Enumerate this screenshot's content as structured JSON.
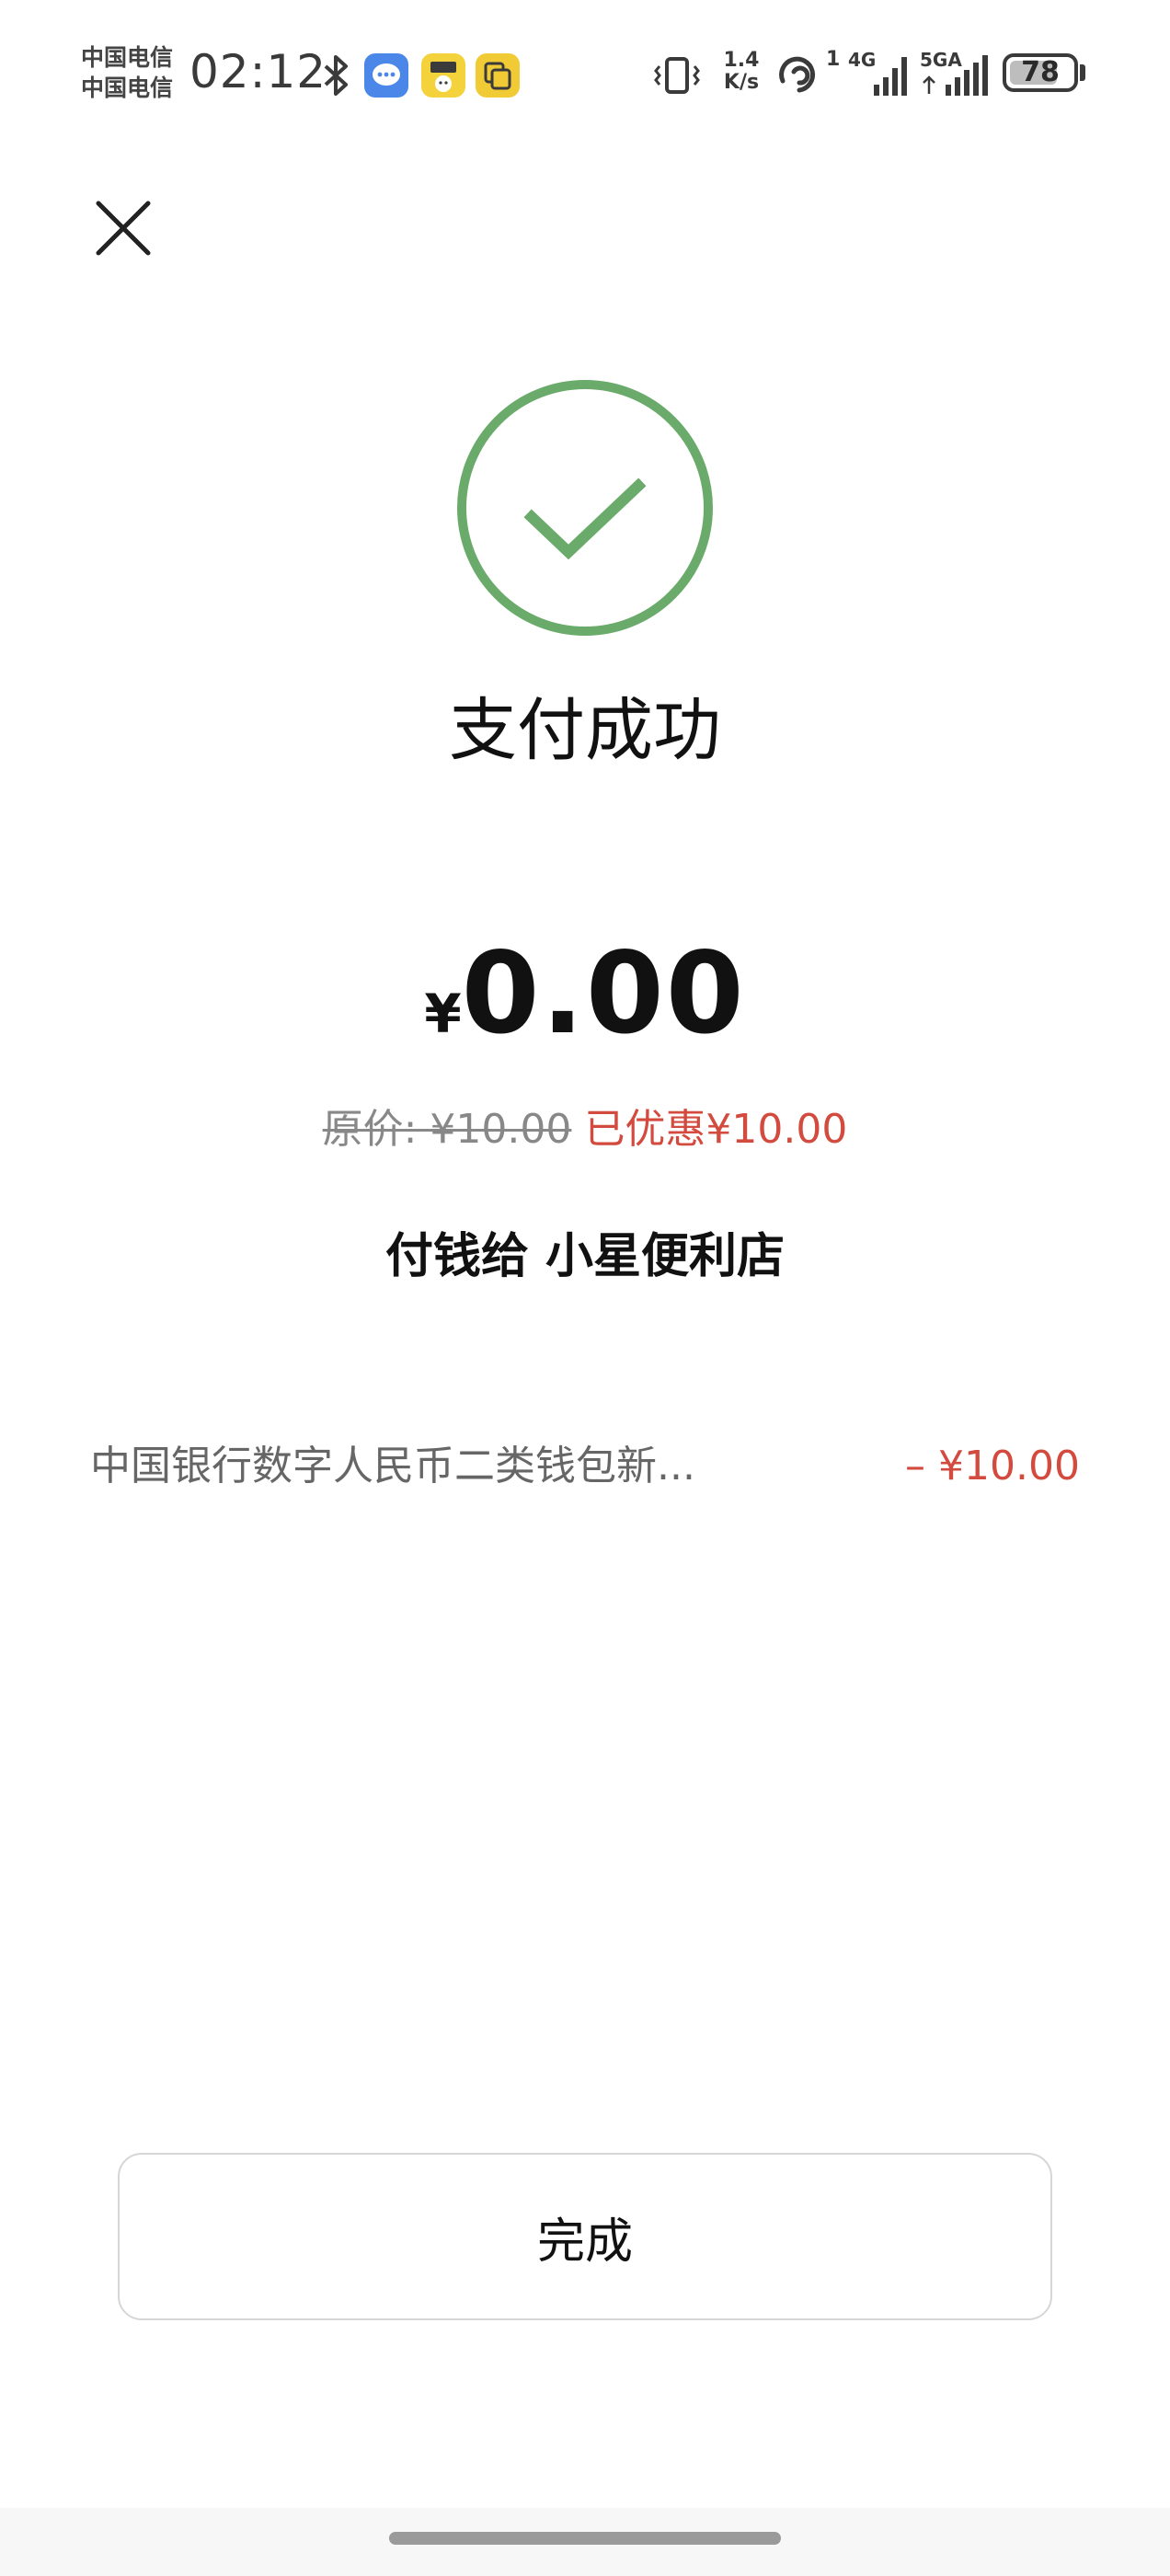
{
  "status_bar": {
    "carrier_1": "中国电信",
    "carrier_2": "中国电信",
    "time": "02:12",
    "net_speed_value": "1.4",
    "net_speed_unit": "K/s",
    "hotspot_count": "1",
    "signal_1_label": "4G",
    "signal_2_label": "5GA",
    "battery_level": "78",
    "battery_fraction": 0.78,
    "icons": [
      "bluetooth-icon",
      "message-app-icon",
      "reader-app-icon",
      "clipboard-app-icon",
      "vibrate-icon",
      "hotspot-icon",
      "signal-icon",
      "battery-icon"
    ]
  },
  "result": {
    "title": "支付成功",
    "currency_symbol": "¥",
    "amount": "0.00",
    "original_price": "原价: ¥10.00",
    "discount": "已优惠¥10.00",
    "payee": "付钱给 小星便利店",
    "success_color": "#6aaa6a"
  },
  "payment": {
    "method": "中国银行数字人民币二类钱包新...",
    "amount": "– ¥10.00"
  },
  "actions": {
    "done_label": "完成"
  },
  "colors": {
    "accent_red": "#d34a3e",
    "success_green": "#6aaa6a"
  }
}
